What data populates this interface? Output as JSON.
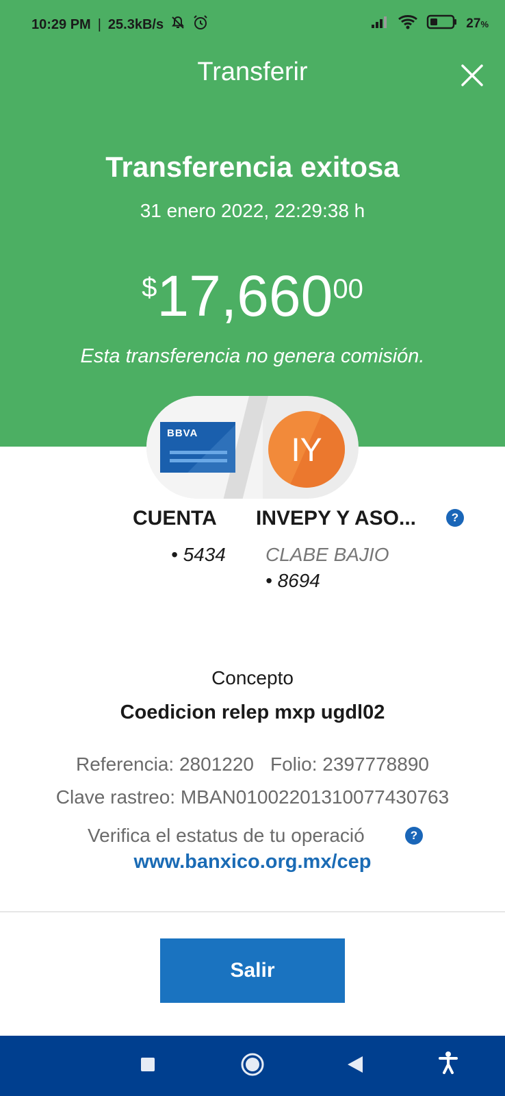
{
  "status_bar": {
    "time": "10:29 PM",
    "separator": "|",
    "speed": "25.3kB/s",
    "battery_pct": "27",
    "battery_unit": "%"
  },
  "header": {
    "title": "Transferir"
  },
  "summary": {
    "status": "Transferencia exitosa",
    "datetime": "31 enero 2022, 22:29:38 h",
    "currency_symbol": "$",
    "amount_main": "17,660",
    "amount_cents": "00",
    "commission_note": "Esta transferencia no genera comisión."
  },
  "from_account": {
    "bank_logo": "BBVA",
    "name": "CUENTA",
    "number": "• 5434"
  },
  "to_account": {
    "avatar_initials": "IY",
    "name": "INVEPY Y ASO...",
    "bank": "CLABE BAJIO",
    "number": "• 8694"
  },
  "details": {
    "concept_label": "Concepto",
    "concept_value": "Coedicion relep mxp ugdl02",
    "reference": "Referencia: 2801220",
    "folio": "Folio: 2397778890",
    "tracking_key": "Clave rastreo: MBAN01002201310077430763",
    "verify_text": "Verifica el estatus de tu operació",
    "help_glyph": "?",
    "verify_link": "www.banxico.org.mx/cep"
  },
  "actions": {
    "exit_label": "Salir"
  },
  "colors": {
    "header_green": "#4caf63",
    "primary_blue": "#1a73c0",
    "link_blue": "#1a6bb5",
    "nav_blue": "#003f8f",
    "avatar_orange": "#f28a3a"
  }
}
